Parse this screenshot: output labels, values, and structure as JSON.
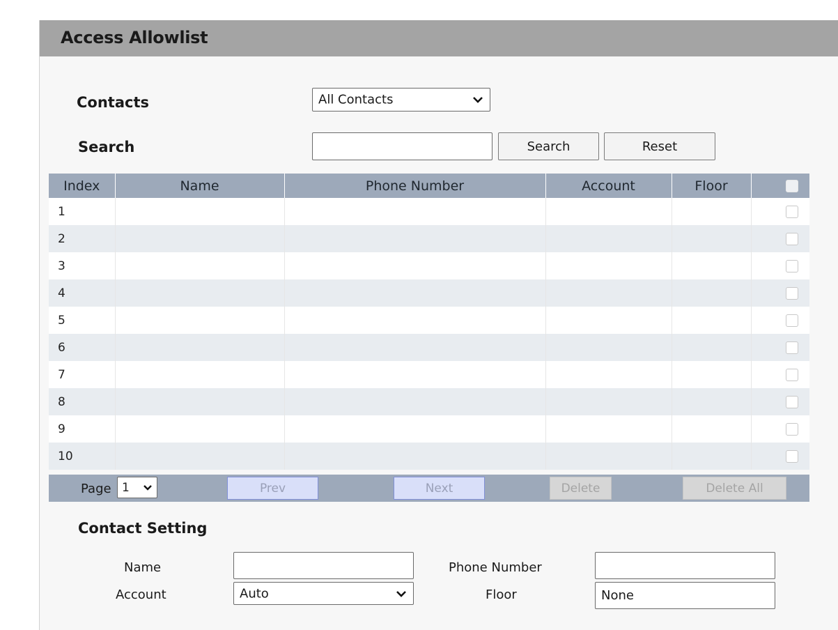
{
  "header": {
    "title": "Access Allowlist"
  },
  "filter": {
    "contacts_label": "Contacts",
    "contacts_selected": "All Contacts",
    "search_label": "Search",
    "search_value": "",
    "search_button": "Search",
    "reset_button": "Reset"
  },
  "table": {
    "columns": [
      "Index",
      "Name",
      "Phone Number",
      "Account",
      "Floor"
    ],
    "rows": [
      {
        "index": "1"
      },
      {
        "index": "2"
      },
      {
        "index": "3"
      },
      {
        "index": "4"
      },
      {
        "index": "5"
      },
      {
        "index": "6"
      },
      {
        "index": "7"
      },
      {
        "index": "8"
      },
      {
        "index": "9"
      },
      {
        "index": "10"
      }
    ]
  },
  "pager": {
    "page_label": "Page",
    "page_selected": "1",
    "prev": "Prev",
    "next": "Next",
    "delete": "Delete",
    "delete_all": "Delete All"
  },
  "contact_setting": {
    "title": "Contact Setting",
    "name_label": "Name",
    "name_value": "",
    "phone_label": "Phone Number",
    "phone_value": "",
    "account_label": "Account",
    "account_selected": "Auto",
    "floor_label": "Floor",
    "floor_value": "None"
  }
}
